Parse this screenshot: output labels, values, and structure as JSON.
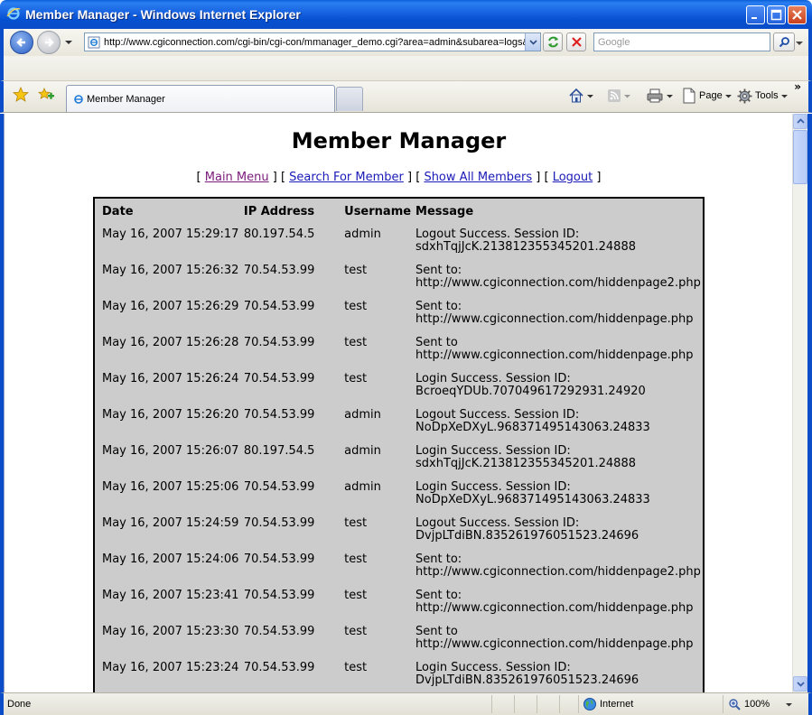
{
  "window": {
    "title": "Member Manager - Windows Internet Explorer"
  },
  "address_bar": {
    "url": "http://www.cgiconnection.com/cgi-bin/cgi-con/mmanager_demo.cgi?area=admin&subarea=logs&"
  },
  "search": {
    "placeholder": "Google"
  },
  "tab": {
    "label": "Member Manager"
  },
  "command_bar": {
    "page_label": "Page",
    "tools_label": "Tools"
  },
  "page": {
    "heading": "Member Manager",
    "nav": {
      "main_menu": "Main Menu",
      "search_member": "Search For Member",
      "show_all": "Show All Members",
      "logout": "Logout"
    },
    "table": {
      "headers": [
        "Date",
        "IP Address",
        "Username",
        "Message"
      ],
      "rows": [
        {
          "date": "May 16, 2007 15:29:17",
          "ip": "80.197.54.5",
          "user": "admin",
          "msg1": "Logout Success. Session ID:",
          "msg2": "sdxhTqjJcK.213812355345201.24888"
        },
        {
          "date": "May 16, 2007 15:26:32",
          "ip": "70.54.53.99",
          "user": "test",
          "msg1": "Sent to:",
          "msg2": "http://www.cgiconnection.com/hiddenpage2.php"
        },
        {
          "date": "May 16, 2007 15:26:29",
          "ip": "70.54.53.99",
          "user": "test",
          "msg1": "Sent to:",
          "msg2": "http://www.cgiconnection.com/hiddenpage.php"
        },
        {
          "date": "May 16, 2007 15:26:28",
          "ip": "70.54.53.99",
          "user": "test",
          "msg1": "Sent to",
          "msg2": "http://www.cgiconnection.com/hiddenpage.php"
        },
        {
          "date": "May 16, 2007 15:26:24",
          "ip": "70.54.53.99",
          "user": "test",
          "msg1": "Login Success. Session ID:",
          "msg2": "BcroeqYDUb.707049617292931.24920"
        },
        {
          "date": "May 16, 2007 15:26:20",
          "ip": "70.54.53.99",
          "user": "admin",
          "msg1": "Logout Success. Session ID:",
          "msg2": "NoDpXeDXyL.968371495143063.24833"
        },
        {
          "date": "May 16, 2007 15:26:07",
          "ip": "80.197.54.5",
          "user": "admin",
          "msg1": "Login Success. Session ID:",
          "msg2": "sdxhTqjJcK.213812355345201.24888"
        },
        {
          "date": "May 16, 2007 15:25:06",
          "ip": "70.54.53.99",
          "user": "admin",
          "msg1": "Login Success. Session ID:",
          "msg2": "NoDpXeDXyL.968371495143063.24833"
        },
        {
          "date": "May 16, 2007 15:24:59",
          "ip": "70.54.53.99",
          "user": "test",
          "msg1": "Logout Success. Session ID:",
          "msg2": "DvjpLTdiBN.835261976051523.24696"
        },
        {
          "date": "May 16, 2007 15:24:06",
          "ip": "70.54.53.99",
          "user": "test",
          "msg1": "Sent to:",
          "msg2": "http://www.cgiconnection.com/hiddenpage2.php"
        },
        {
          "date": "May 16, 2007 15:23:41",
          "ip": "70.54.53.99",
          "user": "test",
          "msg1": "Sent to:",
          "msg2": "http://www.cgiconnection.com/hiddenpage.php"
        },
        {
          "date": "May 16, 2007 15:23:30",
          "ip": "70.54.53.99",
          "user": "test",
          "msg1": "Sent to",
          "msg2": "http://www.cgiconnection.com/hiddenpage.php"
        },
        {
          "date": "May 16, 2007 15:23:24",
          "ip": "70.54.53.99",
          "user": "test",
          "msg1": "Login Success. Session ID:",
          "msg2": "DvjpLTdiBN.835261976051523.24696"
        }
      ]
    }
  },
  "status_bar": {
    "status": "Done",
    "zone": "Internet",
    "zoom": "100%"
  },
  "colors": {
    "frame_blue": "#0b4cc8",
    "table_bg": "#cccccc",
    "link": "#1a1ab8",
    "visited_link": "#7a1a7a"
  }
}
